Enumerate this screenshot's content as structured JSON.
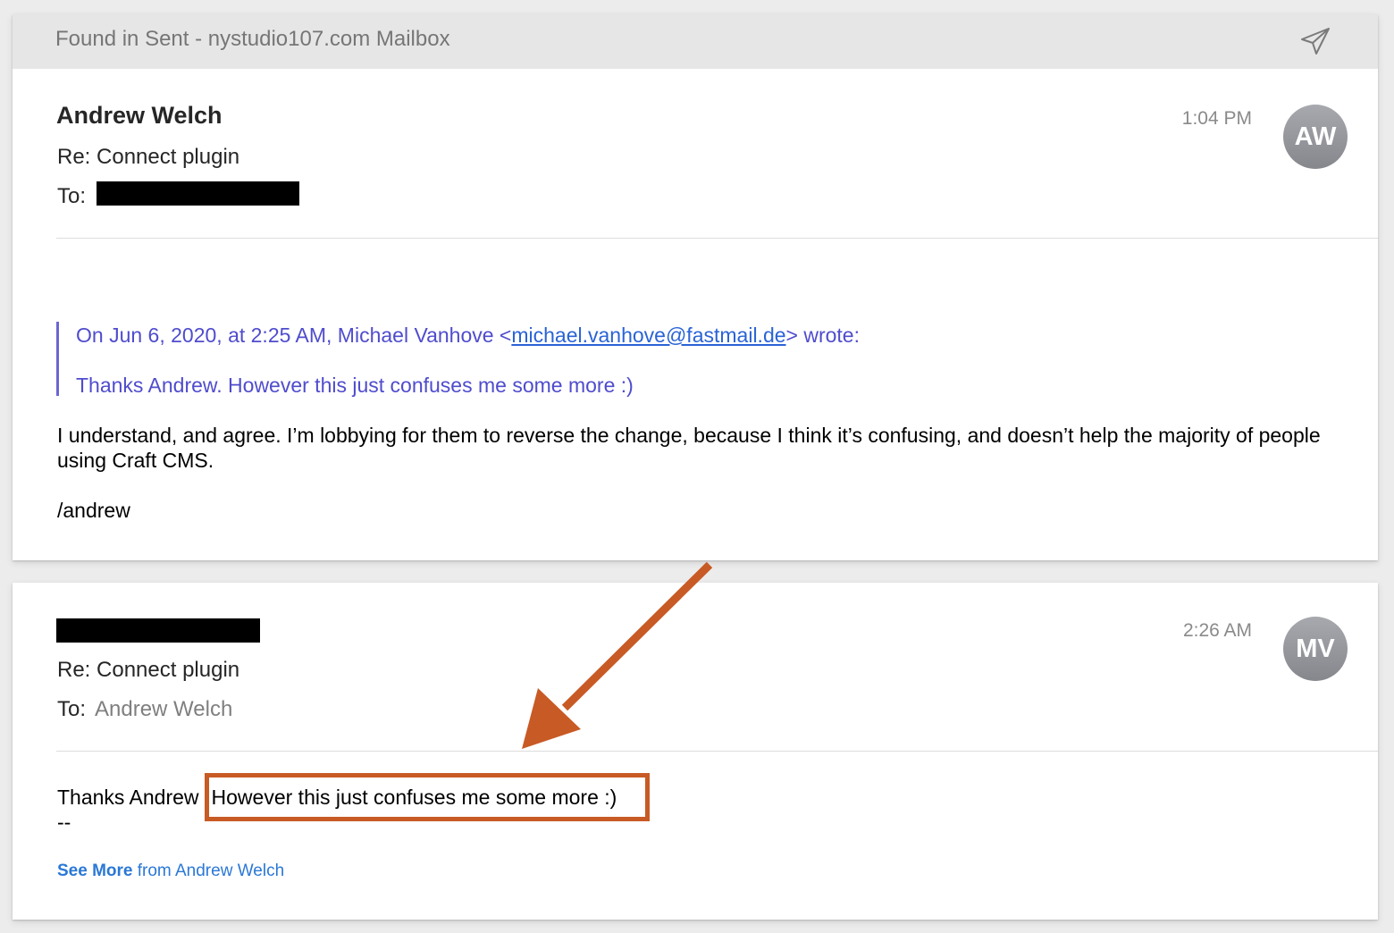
{
  "mailbox": {
    "title": "Found in Sent - nystudio107.com Mailbox",
    "icon": "paper-plane-icon"
  },
  "messages": [
    {
      "sender": "Andrew Welch",
      "subject": "Re: Connect plugin",
      "to_label": "To:",
      "to_value": "",
      "time": "1:04 PM",
      "avatar_initials": "AW",
      "quote": {
        "intro_prefix": "On Jun 6, 2020, at 2:25 AM, Michael Vanhove <",
        "email": "michael.vanhove@fastmail.de",
        "intro_suffix": "> wrote:",
        "text": "Thanks Andrew. However this just confuses me some more :)"
      },
      "body": "I understand, and agree. I’m lobbying for them to reverse the change, because I think it’s confusing, and doesn’t help the majority of people using Craft CMS.",
      "signature": "/andrew"
    },
    {
      "sender": "",
      "subject": "Re: Connect plugin",
      "to_label": "To:",
      "to_value": "Andrew Welch",
      "time": "2:26 AM",
      "avatar_initials": "MV",
      "body_prefix": "Thanks Andrew",
      "body_highlight": "However this just confuses me some more :)",
      "separator": "--",
      "see_more_strong": "See More",
      "see_more_rest": " from Andrew Welch"
    }
  ],
  "colors": {
    "annotation": "#c85a25",
    "quote": "#4f4ccd",
    "link": "#2a78d6"
  }
}
